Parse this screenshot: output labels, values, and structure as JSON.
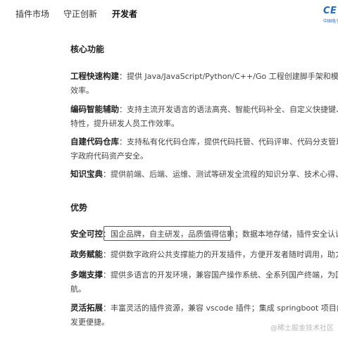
{
  "nav": {
    "items": [
      {
        "label": "插件市场",
        "active": false
      },
      {
        "label": "守正创新",
        "active": false
      },
      {
        "label": "开发者",
        "active": true
      }
    ],
    "logo_text": "CE",
    "logo_sub": "中国电子"
  },
  "core": {
    "heading": "核心功能",
    "items": [
      {
        "term": "工程快速构建",
        "sep": "：",
        "line1": "提供 Java/JavaScript/Python/C++/Go 工程创建脚手架和模板，帮助",
        "line2": "效率。"
      },
      {
        "term": "编码智能辅助",
        "sep": "：",
        "line1": "支持主流开发语言的语法高亮、智能代码补全、自定义快捷键、括",
        "line2": "特性，提升研发人员工作效率。"
      },
      {
        "term": "自建代码仓库",
        "sep": "：",
        "line1": "支持私有化代码仓库，提供代码托管、代码评审、代码分支管理等",
        "line2": "字政府代码资产安全。"
      },
      {
        "term": "知识宝典",
        "sep": "：",
        "line1": "提供前端、后端、运维、测试等研发全流程的知识分享、技术心得、在",
        "line2": ""
      }
    ]
  },
  "advantages": {
    "heading": "优势",
    "items": [
      {
        "term": "安全可控",
        "sep": "：",
        "line1_highlight": "国企品牌，自主研发，品质值得信赖",
        "line1_rest": "；数据本地存储，插件安全认证，",
        "line2": ""
      },
      {
        "term": "政务赋能",
        "sep": "：",
        "line1": "提供数字政府公共支撑能力的开发插件，方便开发者随时调用，助力数",
        "line2": ""
      },
      {
        "term": "多端支撑",
        "sep": "：",
        "line1": "提供多语言的开发环境，兼容国产操作系统、全系列国产终端，为国内",
        "line2": "航。"
      },
      {
        "term": "灵活拓展",
        "sep": "：",
        "line1": "丰富灵活的插件资源，兼容 vscode 插件；集成 springboot 项目向导，",
        "line2": "发更便捷。"
      }
    ]
  },
  "watermark": "@稀土掘金技术社区"
}
